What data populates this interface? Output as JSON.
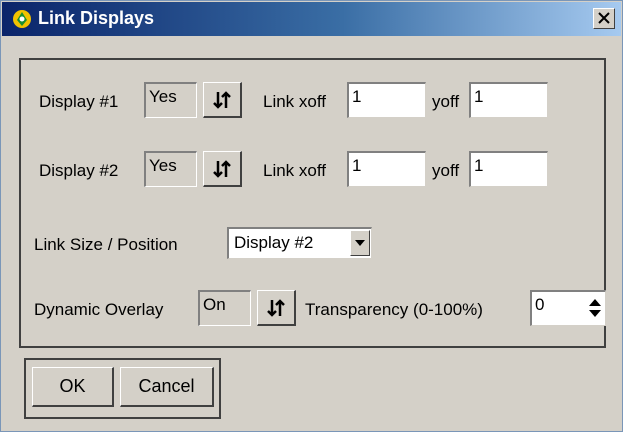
{
  "window": {
    "title": "Link Displays",
    "close_label": "×",
    "title_icon": "app-logo-icon",
    "titlebar_color": "#0a246a"
  },
  "rows": {
    "display1": {
      "label": "Display #1",
      "value": "Yes",
      "link_label": "Link xoff",
      "xoff": "1",
      "yoff_label": "yoff",
      "yoff": "1"
    },
    "display2": {
      "label": "Display #2",
      "value": "Yes",
      "link_label": "Link xoff",
      "xoff": "1",
      "yoff_label": "yoff",
      "yoff": "1"
    }
  },
  "link_size": {
    "label": "Link Size / Position",
    "selected": "Display #2"
  },
  "overlay": {
    "label": "Dynamic Overlay",
    "value": "On",
    "transparency_label": "Transparency (0-100%)",
    "transparency": "0"
  },
  "buttons": {
    "ok": "OK",
    "cancel": "Cancel"
  }
}
